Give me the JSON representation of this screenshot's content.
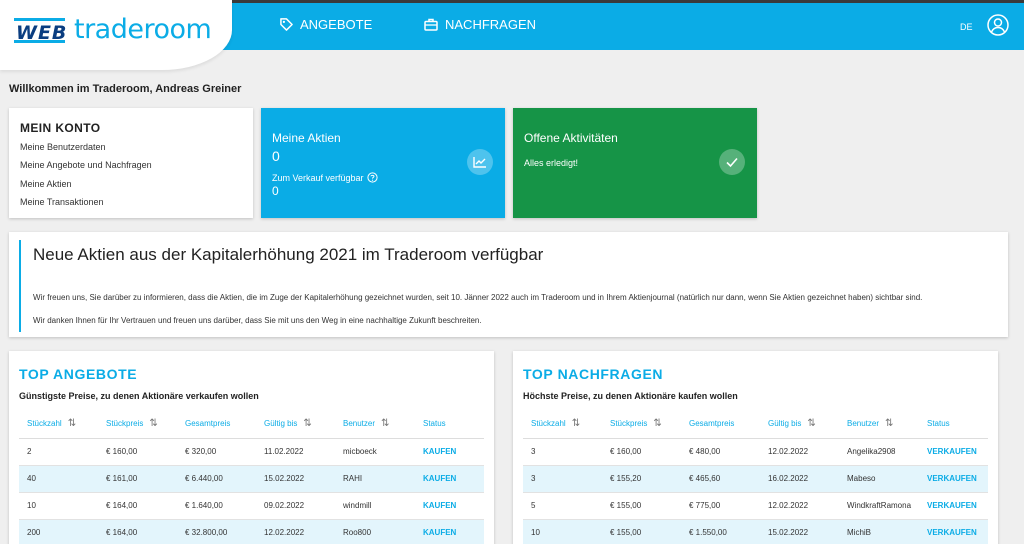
{
  "header": {
    "logo_web": "WEB",
    "logo_trade": "traderoom",
    "nav": [
      {
        "label": "ANGEBOTE",
        "icon": "tag-icon"
      },
      {
        "label": "NACHFRAGEN",
        "icon": "briefcase-icon"
      }
    ],
    "language": "DE",
    "user_icon": "user-circle-icon"
  },
  "welcome": "Willkommen im Traderoom, Andreas Greiner",
  "konto": {
    "title": "MEIN KONTO",
    "links": [
      "Meine Benutzerdaten",
      "Meine Angebote und Nachfragen",
      "Meine Aktien",
      "Meine Transaktionen"
    ]
  },
  "aktien": {
    "title": "Meine Aktien",
    "count": "0",
    "available_label": "Zum Verkauf verfügbar",
    "available_count": "0",
    "icon": "chart-icon",
    "color": "#0aace6"
  },
  "offen": {
    "title": "Offene Aktivitäten",
    "status": "Alles erledigt!",
    "icon": "check-icon",
    "color": "#169447"
  },
  "news": {
    "title": "Neue Aktien aus der Kapitalerhöhung 2021 im Traderoom verfügbar",
    "p1": "Wir freuen uns, Sie darüber zu informieren, dass die Aktien, die im Zuge der Kapitalerhöhung gezeichnet wurden, seit 10. Jänner 2022 auch im Traderoom und in Ihrem Aktienjournal (natürlich nur dann, wenn Sie Aktien gezeichnet haben) sichtbar sind.",
    "p2": "Wir danken Ihnen für Ihr Vertrauen und freuen uns darüber, dass Sie mit uns den Weg in eine nachhaltige Zukunft beschreiten."
  },
  "angebote": {
    "title": "TOP ANGEBOTE",
    "subtitle": "Günstigste Preise, zu denen Aktionäre verkaufen wollen",
    "columns": [
      "Stückzahl",
      "Stückpreis",
      "Gesamtpreis",
      "Gültig bis",
      "Benutzer",
      "Status"
    ],
    "rows": [
      [
        "2",
        "€ 160,00",
        "€ 320,00",
        "11.02.2022",
        "micboeck",
        "KAUFEN"
      ],
      [
        "40",
        "€ 161,00",
        "€ 6.440,00",
        "15.02.2022",
        "RAHI",
        "KAUFEN"
      ],
      [
        "10",
        "€ 164,00",
        "€ 1.640,00",
        "09.02.2022",
        "windmill",
        "KAUFEN"
      ],
      [
        "200",
        "€ 164,00",
        "€ 32.800,00",
        "12.02.2022",
        "Roo800",
        "KAUFEN"
      ]
    ]
  },
  "nachfragen": {
    "title": "TOP NACHFRAGEN",
    "subtitle": "Höchste Preise, zu denen Aktionäre kaufen wollen",
    "columns": [
      "Stückzahl",
      "Stückpreis",
      "Gesamtpreis",
      "Gültig bis",
      "Benutzer",
      "Status"
    ],
    "rows": [
      [
        "3",
        "€ 160,00",
        "€ 480,00",
        "12.02.2022",
        "Angelika2908",
        "VERKAUFEN"
      ],
      [
        "3",
        "€ 155,20",
        "€ 465,60",
        "16.02.2022",
        "Mabeso",
        "VERKAUFEN"
      ],
      [
        "5",
        "€ 155,00",
        "€ 775,00",
        "12.02.2022",
        "WindkraftRamona",
        "VERKAUFEN"
      ],
      [
        "10",
        "€ 155,00",
        "€ 1.550,00",
        "15.02.2022",
        "MichiB",
        "VERKAUFEN"
      ]
    ]
  }
}
